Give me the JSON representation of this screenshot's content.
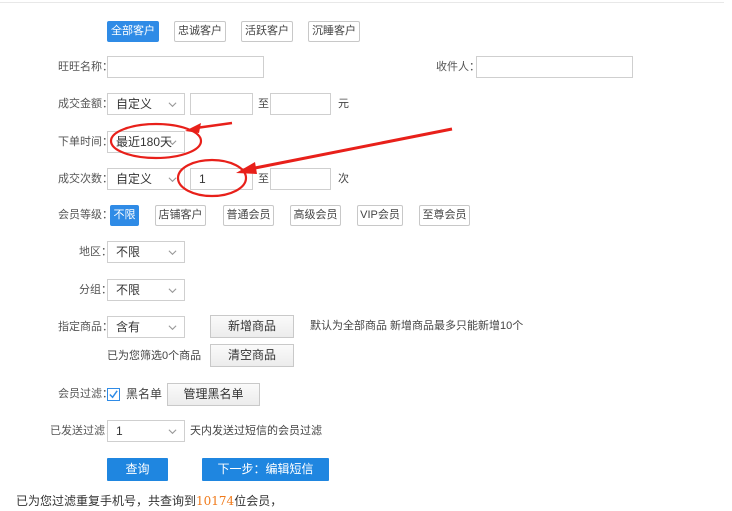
{
  "segments": {
    "all": "全部客户",
    "loyal": "忠诚客户",
    "active": "活跃客户",
    "dormant": "沉睡客户"
  },
  "fields": {
    "wangwang_label": "旺旺名称：",
    "wangwang_value": "",
    "receiver_label": "收件人：",
    "receiver_value": "",
    "amount_label": "成交金额：",
    "amount_select": "自定义",
    "amount_min": "",
    "amount_to": "至",
    "amount_max": "",
    "amount_unit": "元",
    "order_time_label": "下单时间：",
    "order_time_select": "最近180天",
    "count_label": "成交次数：",
    "count_select": "自定义",
    "count_min": "1",
    "count_to": "至",
    "count_max": "",
    "count_unit": "次"
  },
  "member_level": {
    "label": "会员等级：",
    "options": [
      "不限",
      "店铺客户",
      "普通会员",
      "高级会员",
      "VIP会员",
      "至尊会员"
    ],
    "selected": "不限"
  },
  "region": {
    "label": "地区：",
    "value": "不限"
  },
  "group": {
    "label": "分组：",
    "value": "不限"
  },
  "product": {
    "label": "指定商品：",
    "select": "含有",
    "add_button": "新增商品",
    "hint": "默认为全部商品 新增商品最多只能新增10个",
    "selected_text": "已为您筛选0个商品",
    "clear_button": "清空商品"
  },
  "member_filter": {
    "label": "会员过滤：",
    "blacklist_checked": true,
    "blacklist_label": "黑名单",
    "manage_button": "管理黑名单"
  },
  "sent_filter": {
    "label": "已发送过滤：",
    "value": "1",
    "suffix": "天内发送过短信的会员过滤"
  },
  "actions": {
    "query": "查询",
    "next": "下一步：编辑短信"
  },
  "result": {
    "prefix": "已为您过滤重复手机号，共查询到",
    "count": "10174",
    "suffix": "位会员，"
  },
  "colors": {
    "accent": "#2f8be6",
    "annotation": "#e8201a",
    "count": "#f07a1a"
  }
}
